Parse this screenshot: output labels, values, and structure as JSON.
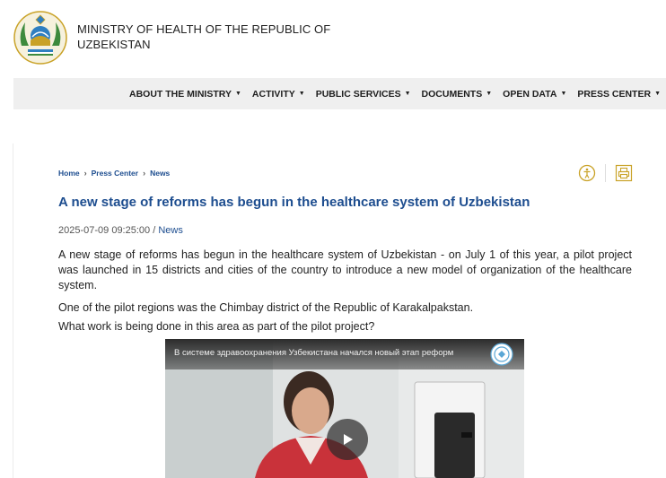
{
  "header": {
    "ministry_name": "MINISTRY OF HEALTH OF THE REPUBLIC OF UZBEKISTAN"
  },
  "nav": {
    "items": [
      {
        "label": "ABOUT THE MINISTRY"
      },
      {
        "label": "ACTIVITY"
      },
      {
        "label": "PUBLIC SERVICES"
      },
      {
        "label": "DOCUMENTS"
      },
      {
        "label": "OPEN DATA"
      },
      {
        "label": "PRESS CENTER"
      }
    ]
  },
  "breadcrumb": {
    "items": [
      "Home",
      "Press Center",
      "News"
    ]
  },
  "article": {
    "title": "A new stage of reforms has begun in the healthcare system of Uzbekistan",
    "datetime": "2025-07-09 09:25:00",
    "separator": " / ",
    "category": "News",
    "paragraphs": [
      "A new stage of reforms has begun in the healthcare system of Uzbekistan - on July 1 of this year, a pilot project was launched in 15 districts and cities of the country to introduce a new model of organization of the healthcare system.",
      "One of the pilot regions was the Chimbay district of the Republic of Karakalpakstan.",
      "What work is being done in this area as part of the pilot project?"
    ]
  },
  "video": {
    "title": "В системе здравоохранения Узбекистана начался новый этап реформ"
  },
  "icons": {
    "emblem": "state-emblem-icon",
    "accessibility": "accessibility-icon",
    "print": "print-icon",
    "play": "play-icon",
    "nav_caret": "caret-down-icon",
    "breadcrumb_sep": "chevron-right-icon"
  },
  "colors": {
    "accent": "#1d4d8f",
    "gold": "#c9a227",
    "nav_bg": "#efefef"
  }
}
